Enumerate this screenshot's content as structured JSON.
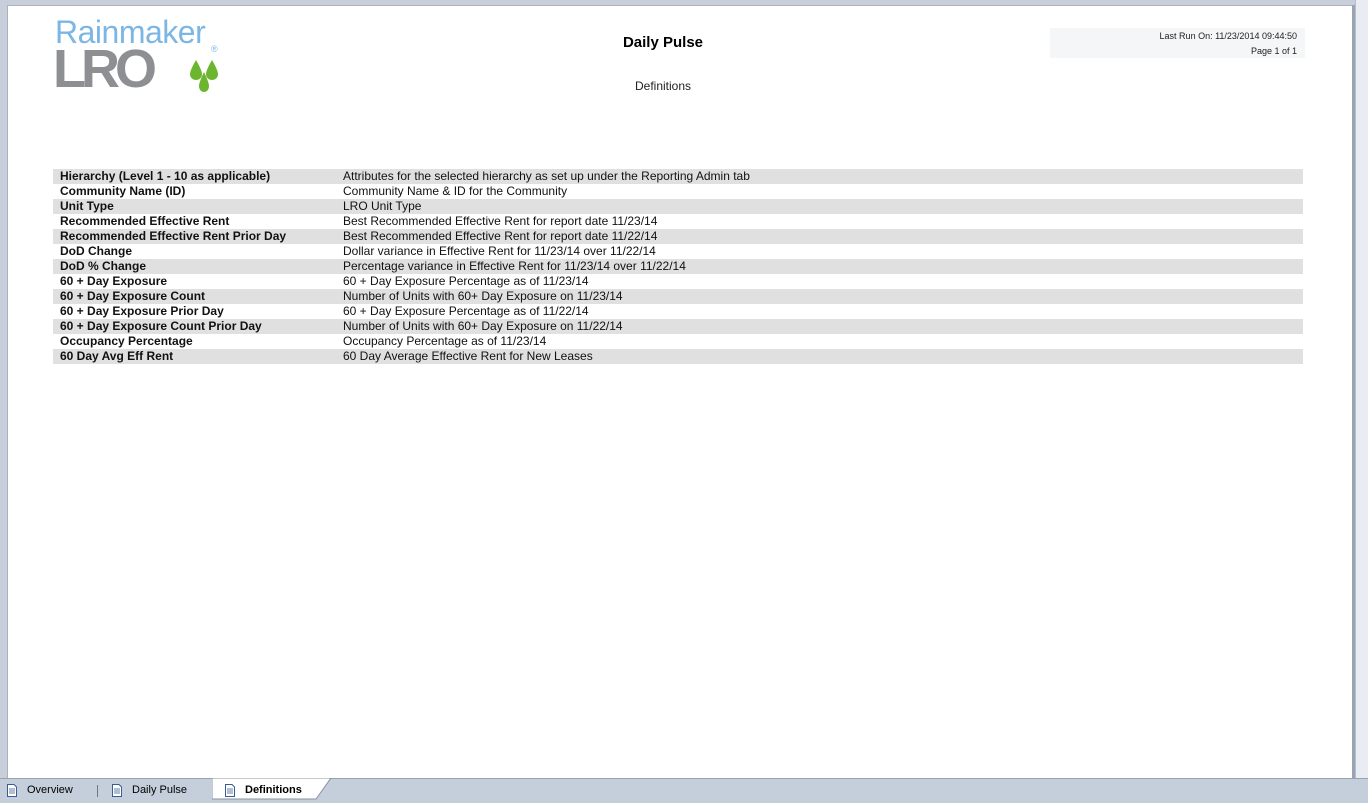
{
  "logo": {
    "word_top": "Rainmaker",
    "word_bottom": "LRO",
    "registered_mark": "®",
    "colors": {
      "top": "#7cb6e4",
      "bottom": "#8d8f92",
      "drops": "#6cb52e"
    }
  },
  "report": {
    "title": "Daily Pulse",
    "subtitle": "Definitions",
    "last_run": "Last Run On: 11/23/2014 09:44:50",
    "page": "Page 1 of 1"
  },
  "definitions": [
    {
      "term": "Hierarchy (Level 1 - 10 as applicable)",
      "description": "Attributes for the selected hierarchy as set up under the Reporting Admin tab"
    },
    {
      "term": "Community Name (ID)",
      "description": "Community Name & ID for the Community"
    },
    {
      "term": "Unit Type",
      "description": "LRO Unit Type"
    },
    {
      "term": "Recommended Effective Rent",
      "description": "Best Recommended Effective Rent for report date 11/23/14"
    },
    {
      "term": "Recommended Effective Rent Prior Day",
      "description": "Best Recommended Effective Rent for report date 11/22/14"
    },
    {
      "term": "DoD Change",
      "description": "Dollar variance in Effective Rent for 11/23/14 over 11/22/14"
    },
    {
      "term": "DoD % Change",
      "description": "Percentage variance in Effective Rent for 11/23/14 over 11/22/14"
    },
    {
      "term": "60 + Day Exposure",
      "description": "60 + Day Exposure Percentage as of 11/23/14"
    },
    {
      "term": "60 + Day Exposure Count",
      "description": "Number of Units with 60+ Day Exposure on 11/23/14"
    },
    {
      "term": "60 + Day Exposure Prior Day",
      "description": "60 + Day Exposure Percentage as of 11/22/14"
    },
    {
      "term": "60 + Day Exposure Count Prior Day",
      "description": "Number of Units with 60+ Day Exposure on 11/22/14"
    },
    {
      "term": "Occupancy Percentage",
      "description": "Occupancy Percentage as of 11/23/14"
    },
    {
      "term": "60 Day Avg Eff Rent",
      "description": "60 Day Average Effective Rent for New Leases"
    }
  ],
  "tabs": [
    {
      "label": "Overview",
      "icon": "document-icon",
      "active": false
    },
    {
      "label": "Daily Pulse",
      "icon": "document-icon",
      "active": false
    },
    {
      "label": "Definitions",
      "icon": "document-icon",
      "active": true
    }
  ]
}
